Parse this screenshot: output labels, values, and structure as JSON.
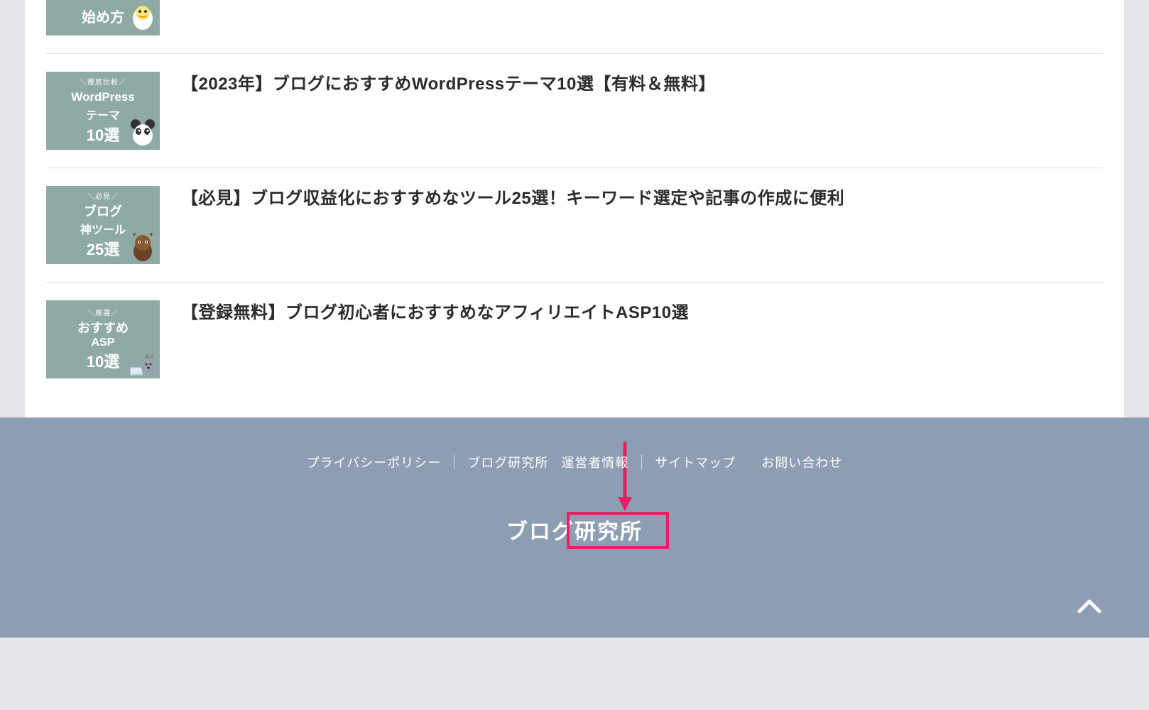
{
  "articles": [
    {
      "thumb": {
        "tag": "",
        "line1": "始め方",
        "line2": "",
        "count": ""
      },
      "title": ""
    },
    {
      "thumb": {
        "tag": "＼徹底比較／",
        "line1": "WordPress",
        "line2": "テーマ",
        "count": "10選"
      },
      "title": "【2023年】ブログにおすすめWordPressテーマ10選【有料＆無料】"
    },
    {
      "thumb": {
        "tag": "＼必見／",
        "line1": "ブログ",
        "line2": "神ツール",
        "count": "25選"
      },
      "title": "【必見】ブログ収益化におすすめなツール25選！キーワード選定や記事の作成に便利"
    },
    {
      "thumb": {
        "tag": "＼厳選／",
        "line1": "おすすめ",
        "line2": "ASP",
        "count": "10選"
      },
      "title": "【登録無料】ブログ初心者におすすめなアフィリエイトASP10選"
    }
  ],
  "footer": {
    "nav": [
      "プライバシーポリシー",
      "ブログ研究所",
      "運営者情報",
      "サイトマップ",
      "お問い合わせ"
    ],
    "title": "ブログ研究所"
  },
  "annotation": {
    "highlighted_nav_item": "サイトマップ",
    "accent_color": "#e91e63"
  }
}
